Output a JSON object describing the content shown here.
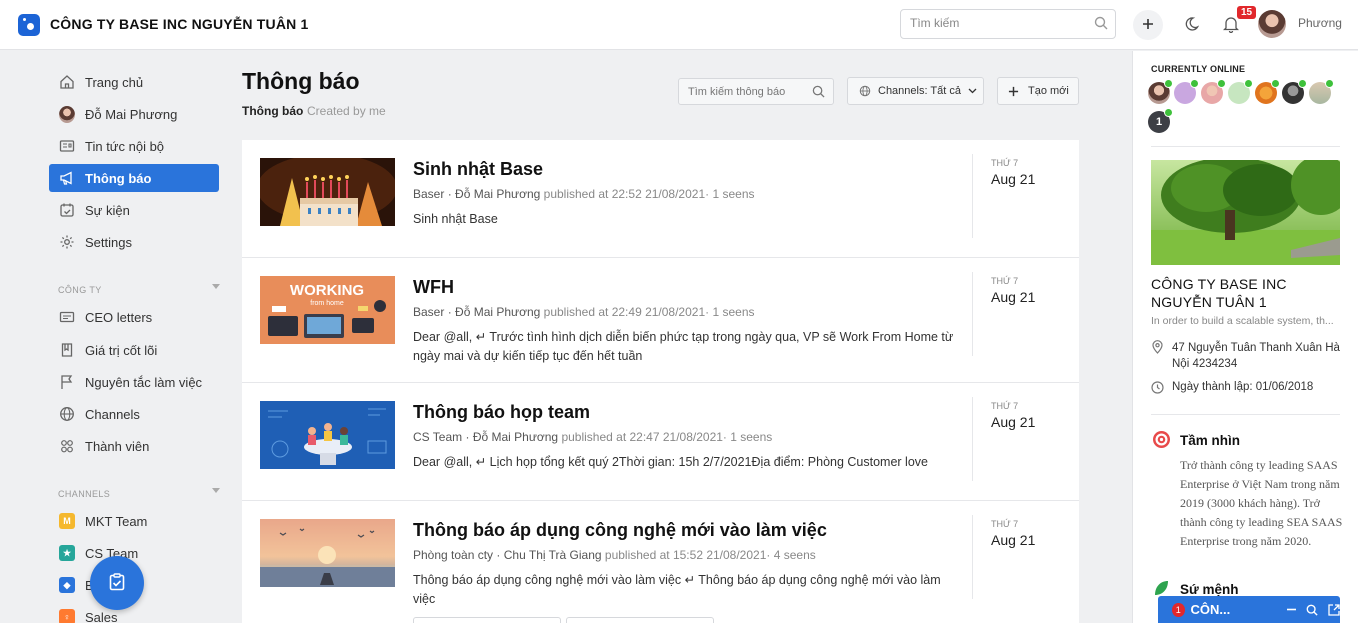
{
  "header": {
    "company": "CÔNG TY BASE INC NGUYỄN TUÂN 1",
    "search_placeholder": "Tìm kiếm",
    "notif_count": "15",
    "username": "Phương"
  },
  "sidebar": {
    "items": [
      {
        "label": "Trang chủ",
        "icon": "home-icon"
      },
      {
        "label": "Đỗ Mai Phương",
        "icon": "avatar"
      },
      {
        "label": "Tin tức nội bộ",
        "icon": "news-icon"
      },
      {
        "label": "Thông báo",
        "icon": "megaphone-icon",
        "active": true
      },
      {
        "label": "Sự kiện",
        "icon": "calendar-icon"
      },
      {
        "label": "Settings",
        "icon": "gear-icon"
      }
    ],
    "company_section": "CÔNG TY",
    "company_items": [
      {
        "label": "CEO letters",
        "icon": "mail-icon"
      },
      {
        "label": "Giá trị cốt lõi",
        "icon": "book-icon"
      },
      {
        "label": "Nguyên tắc làm việc",
        "icon": "flag-icon"
      },
      {
        "label": "Channels",
        "icon": "globe-icon"
      },
      {
        "label": "Thành viên",
        "icon": "members-icon"
      }
    ],
    "channels_section": "CHANNELS",
    "channels": [
      {
        "label": "MKT Team",
        "badge": "M",
        "color": "#f5b82e"
      },
      {
        "label": "CS Team",
        "badge": "★",
        "color": "#26a69a"
      },
      {
        "label": "B",
        "badge": "◆",
        "color": "#2a74db"
      },
      {
        "label": "Sales",
        "badge": "♀",
        "color": "#ff7a30"
      }
    ]
  },
  "main": {
    "title": "Thông báo",
    "tabs": [
      "Thông báo",
      "Created by me"
    ],
    "search_placeholder": "Tìm kiếm thông báo",
    "channels_button": "Channels: Tất cả",
    "new_button": "Tạo mới",
    "posts": [
      {
        "title": "Sinh nhật Base",
        "channel": "Baser",
        "author": "Đỗ Mai Phương",
        "published": "published at 22:52 21/08/2021",
        "seens": "· 1 seens",
        "body": "Sinh nhật Base",
        "weekday": "THỨ 7",
        "date": "Aug 21"
      },
      {
        "title": "WFH",
        "channel": "Baser",
        "author": "Đỗ Mai Phương",
        "published": "published at 22:49 21/08/2021",
        "seens": "· 1 seens",
        "body": "Dear @all, ↵ Trước tình hình dịch diễn biến phức tạp trong ngày qua, VP sẽ Work From Home từ ngày mai và dự kiến tiếp tục đến hết tuần",
        "thumb_text_1": "WORKING",
        "thumb_text_2": "from home",
        "weekday": "THỨ 7",
        "date": "Aug 21"
      },
      {
        "title": "Thông báo họp team",
        "channel": "CS Team",
        "author": "Đỗ Mai Phương",
        "published": "published at 22:47 21/08/2021",
        "seens": "· 1 seens",
        "body": "Dear @all, ↵ Lịch họp tổng kết quý 2Thời gian: 15h 2/7/2021Địa điểm: Phòng Customer love",
        "weekday": "THỨ 7",
        "date": "Aug 21"
      },
      {
        "title": "Thông báo áp dụng công nghệ mới vào làm việc",
        "channel": "Phòng toàn cty",
        "author": "Chu Thị Trà Giang",
        "published": "published at 15:52 21/08/2021",
        "seens": "· 4 seens",
        "body": "Thông báo áp dụng công nghệ mới vào làm việc ↵ Thông báo áp dụng công nghệ mới vào làm việc",
        "weekday": "THỨ 7",
        "date": "Aug 21"
      }
    ]
  },
  "right_panel": {
    "online_title": "CURRENTLY ONLINE",
    "online_extra": "1",
    "company_name": "CÔNG TY BASE INC NGUYỄN TUÂN 1",
    "company_desc": "In order to build a scalable system, th...",
    "address": "47 Nguyễn Tuân Thanh Xuân Hà Nội 4234234",
    "founded": "Ngày thành lập: 01/06/2018",
    "vision_title": "Tầm nhìn",
    "vision_body": "Trở thành công ty leading SAAS Enterprise ở Việt Nam trong năm 2019 (3000 khách hàng). Trở thành công ty leading SEA SAAS Enterprise trong năm 2020.",
    "mission_title": "Sứ mệnh"
  },
  "chat": {
    "count": "1",
    "label": "CÔN..."
  },
  "colors": {
    "accent": "#2a74db",
    "online": "#3ec13b",
    "badge": "#e1282c"
  }
}
